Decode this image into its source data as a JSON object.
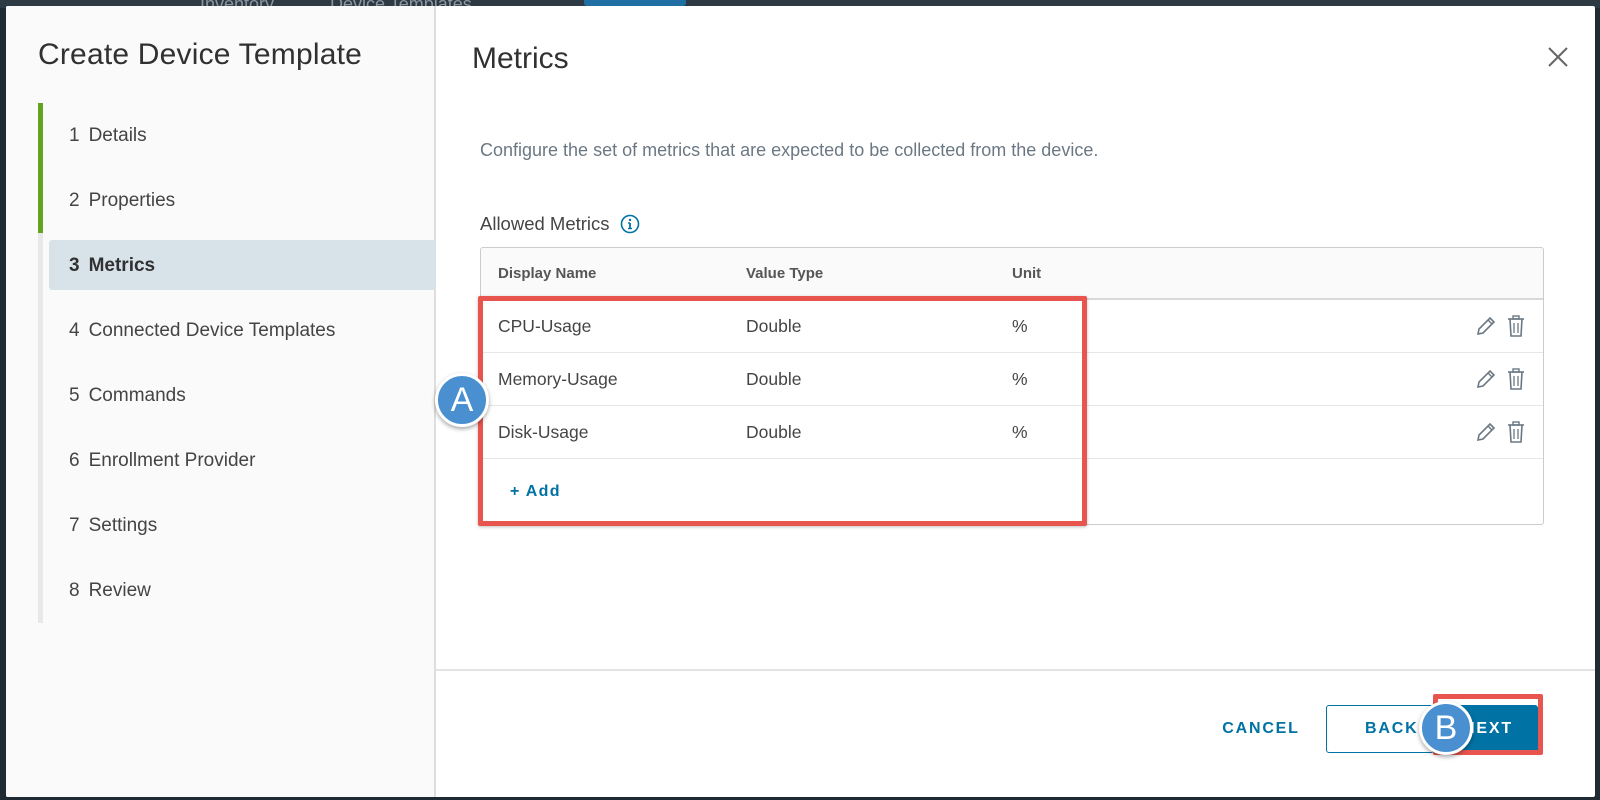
{
  "background": {
    "tabs": [
      "Inventory",
      "Device Templates"
    ]
  },
  "sidebar": {
    "title": "Create Device Template",
    "steps": [
      {
        "num": "1",
        "label": "Details",
        "state": "done"
      },
      {
        "num": "2",
        "label": "Properties",
        "state": "done"
      },
      {
        "num": "3",
        "label": "Metrics",
        "state": "active"
      },
      {
        "num": "4",
        "label": "Connected Device Templates",
        "state": "pending"
      },
      {
        "num": "5",
        "label": "Commands",
        "state": "pending"
      },
      {
        "num": "6",
        "label": "Enrollment Provider",
        "state": "pending"
      },
      {
        "num": "7",
        "label": "Settings",
        "state": "pending"
      },
      {
        "num": "8",
        "label": "Review",
        "state": "pending"
      }
    ]
  },
  "main": {
    "title": "Metrics",
    "description": "Configure the set of metrics that are expected to be collected from the device.",
    "allowed_label": "Allowed Metrics",
    "table": {
      "headers": [
        "Display Name",
        "Value Type",
        "Unit"
      ],
      "rows": [
        {
          "name": "CPU-Usage",
          "type": "Double",
          "unit": "%"
        },
        {
          "name": "Memory-Usage",
          "type": "Double",
          "unit": "%"
        },
        {
          "name": "Disk-Usage",
          "type": "Double",
          "unit": "%"
        }
      ],
      "add_label": "+ Add"
    }
  },
  "footer": {
    "cancel_label": "CANCEL",
    "back_label": "BACK",
    "next_label": "NEXT"
  },
  "annotations": {
    "marker_a": "A",
    "marker_b": "B"
  },
  "colors": {
    "accent": "#0072a3",
    "step_done": "#62a420",
    "annotation_red": "#e8554e",
    "marker_blue": "#4a90d0"
  }
}
